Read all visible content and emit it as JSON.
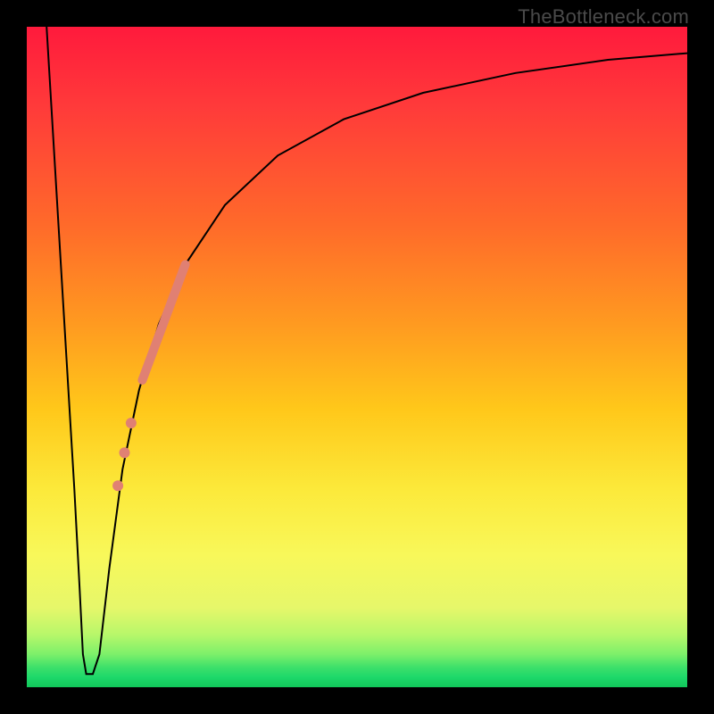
{
  "watermark": "TheBottleneck.com",
  "chart_data": {
    "type": "line",
    "title": "",
    "xlabel": "",
    "ylabel": "",
    "xlim": [
      0,
      100
    ],
    "ylim": [
      0,
      100
    ],
    "background_gradient": {
      "direction": "vertical",
      "stops": [
        {
          "pos": 0.0,
          "color": "#ff1a3c"
        },
        {
          "pos": 0.3,
          "color": "#ff6a2a"
        },
        {
          "pos": 0.58,
          "color": "#ffc81a"
        },
        {
          "pos": 0.8,
          "color": "#f8f85a"
        },
        {
          "pos": 0.95,
          "color": "#7df06a"
        },
        {
          "pos": 1.0,
          "color": "#12c75a"
        }
      ]
    },
    "series": [
      {
        "name": "bottleneck-curve",
        "stroke": "#000000",
        "stroke_width": 2,
        "points": [
          {
            "x": 3.0,
            "y": 100.0
          },
          {
            "x": 4.5,
            "y": 75.0
          },
          {
            "x": 6.0,
            "y": 50.0
          },
          {
            "x": 7.2,
            "y": 30.0
          },
          {
            "x": 8.0,
            "y": 15.0
          },
          {
            "x": 8.5,
            "y": 5.0
          },
          {
            "x": 9.0,
            "y": 2.0
          },
          {
            "x": 10.0,
            "y": 2.0
          },
          {
            "x": 11.0,
            "y": 5.0
          },
          {
            "x": 12.5,
            "y": 18.0
          },
          {
            "x": 14.5,
            "y": 33.0
          },
          {
            "x": 17.0,
            "y": 45.0
          },
          {
            "x": 20.0,
            "y": 55.0
          },
          {
            "x": 24.0,
            "y": 64.0
          },
          {
            "x": 30.0,
            "y": 73.0
          },
          {
            "x": 38.0,
            "y": 80.5
          },
          {
            "x": 48.0,
            "y": 86.0
          },
          {
            "x": 60.0,
            "y": 90.0
          },
          {
            "x": 74.0,
            "y": 93.0
          },
          {
            "x": 88.0,
            "y": 95.0
          },
          {
            "x": 100.0,
            "y": 96.0
          }
        ]
      },
      {
        "name": "highlight-segment",
        "stroke": "#e08073",
        "stroke_width": 10,
        "linecap": "round",
        "points": [
          {
            "x": 17.5,
            "y": 46.5
          },
          {
            "x": 24.0,
            "y": 64.0
          }
        ]
      }
    ],
    "markers": [
      {
        "name": "dot-3",
        "x": 15.8,
        "y": 40.0,
        "r": 6,
        "fill": "#e08073"
      },
      {
        "name": "dot-2",
        "x": 14.8,
        "y": 35.5,
        "r": 6,
        "fill": "#e08073"
      },
      {
        "name": "dot-1",
        "x": 13.8,
        "y": 30.5,
        "r": 6,
        "fill": "#e08073"
      }
    ]
  }
}
